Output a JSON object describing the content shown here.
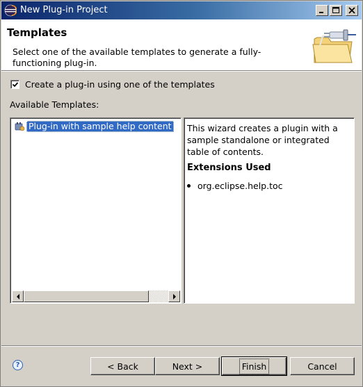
{
  "window": {
    "title": "New Plug-in Project",
    "controls": [
      "minimize",
      "maximize",
      "close"
    ]
  },
  "header": {
    "title": "Templates",
    "description": "Select one of the available templates to generate a fully-functioning plug-in.",
    "banner_icon": "folder-plug-icon"
  },
  "options": {
    "use_template_label": "Create a plug-in using one of the templates",
    "use_template_checked": true
  },
  "templates": {
    "label": "Available Templates:",
    "items": [
      {
        "label": "Plug-in with sample help content",
        "selected": true,
        "icon": "plugin-icon"
      }
    ]
  },
  "description_pane": {
    "text": "This wizard creates a plugin with a sample standalone or integrated table of contents.",
    "extensions_heading": "Extensions Used",
    "extensions": [
      "org.eclipse.help.toc"
    ]
  },
  "footer": {
    "help_icon": "help-icon",
    "back_label": "< Back",
    "next_label": "Next >",
    "finish_label": "Finish",
    "cancel_label": "Cancel"
  },
  "colors": {
    "titlebar_start": "#0a246a",
    "titlebar_end": "#a6caf0",
    "selection": "#316ac5",
    "dialog_bg": "#d4d0c8"
  }
}
